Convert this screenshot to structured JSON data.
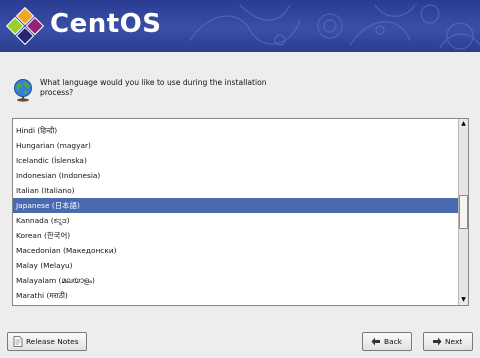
{
  "header": {
    "brand": "CentOS"
  },
  "prompt": {
    "text": "What language would you like to use during the installation process?"
  },
  "languages": [
    {
      "label": "Hindi (हिन्दी)",
      "selected": false
    },
    {
      "label": "Hungarian (magyar)",
      "selected": false
    },
    {
      "label": "Icelandic (Íslenska)",
      "selected": false
    },
    {
      "label": "Indonesian (Indonesia)",
      "selected": false
    },
    {
      "label": "Italian (Italiano)",
      "selected": false
    },
    {
      "label": "Japanese (日本語)",
      "selected": true
    },
    {
      "label": "Kannada (ಕನ್ನಡ)",
      "selected": false
    },
    {
      "label": "Korean (한국어)",
      "selected": false
    },
    {
      "label": "Macedonian (Македонски)",
      "selected": false
    },
    {
      "label": "Malay (Melayu)",
      "selected": false
    },
    {
      "label": "Malayalam (മലയാളം)",
      "selected": false
    },
    {
      "label": "Marathi (मराठी)",
      "selected": false
    }
  ],
  "buttons": {
    "release_notes": "Release Notes",
    "back": "Back",
    "next": "Next"
  },
  "colors": {
    "banner": "#2f4396",
    "selection": "#4a6ab0"
  }
}
